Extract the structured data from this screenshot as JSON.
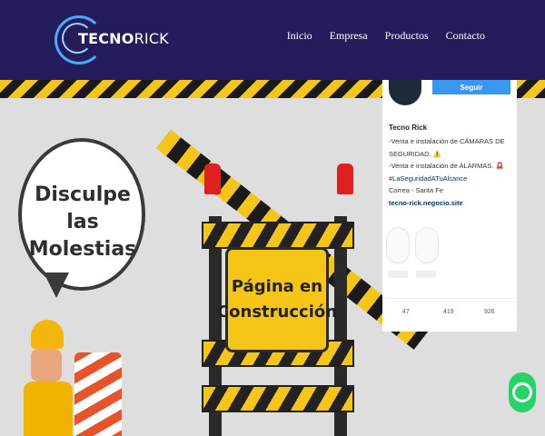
{
  "navbar": {
    "logo_text_1": "TECNO",
    "logo_text_2": "RICK",
    "items": [
      {
        "label": "Inicio"
      },
      {
        "label": "Empresa"
      },
      {
        "label": "Productos"
      },
      {
        "label": "Contacto"
      }
    ],
    "bg_color": "#231d5c"
  },
  "hero": {
    "bubble_line1": "Disculpe las",
    "bubble_line2": "Molestias",
    "sign_line1": "Página en",
    "sign_line2": "Construcción"
  },
  "instagram": {
    "follow_label": "Seguir",
    "name": "Tecno Rick",
    "bio_1": "-Venta e instalación de CÁMARAS DE SEGURIDAD. ⚠️",
    "bio_2": "-Venta e instalación de ALARMAS. 🚨",
    "hashtag": "#LaSeguridadATuAlcance",
    "location": "Correa - Santa Fe",
    "link": "tecno-rick.negocio.site",
    "stats": [
      "47",
      "419",
      "926"
    ]
  },
  "icons": {
    "whatsapp": "whatsapp-icon",
    "logo": "logo-icon"
  }
}
